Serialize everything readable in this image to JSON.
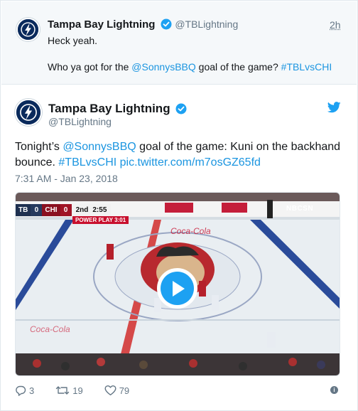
{
  "parent_tweet": {
    "name": "Tampa Bay Lightning",
    "handle": "@TBLightning",
    "time": "2h",
    "line1": "Heck yeah.",
    "line2_prefix": "Who ya got for the ",
    "line2_mention": "@SonnysBBQ",
    "line2_middle": " goal of the game? ",
    "line2_hashtag": "#TBLvsCHI"
  },
  "main_tweet": {
    "name": "Tampa Bay Lightning",
    "handle": "@TBLightning",
    "text_prefix": "Tonight’s ",
    "text_mention": "@SonnysBBQ",
    "text_middle": " goal of the game: Kuni on the backhand bounce. ",
    "text_hashtag": "#TBLvsCHI",
    "text_link": " pic.twitter.com/m7osGZ65fd",
    "timestamp": "7:31 AM - Jan 23, 2018"
  },
  "video": {
    "scorebug": {
      "team1": "TB",
      "score1": "0",
      "team2": "CHI",
      "score2": "0",
      "period": "2nd",
      "clock": "2:55",
      "power_play": "POWER PLAY 3:01"
    },
    "network": "NBCSN"
  },
  "actions": {
    "replies": "3",
    "retweets": "19",
    "likes": "79"
  },
  "icons": {
    "verified": "verified-badge-icon",
    "twitter": "twitter-bird-icon",
    "reply": "reply-icon",
    "retweet": "retweet-icon",
    "like": "heart-icon",
    "info": "info-icon",
    "play": "play-icon"
  },
  "colors": {
    "link": "#1b95e0",
    "accent": "#1da1f2",
    "muted": "#657786",
    "parent_bg": "#f5f8fa"
  }
}
